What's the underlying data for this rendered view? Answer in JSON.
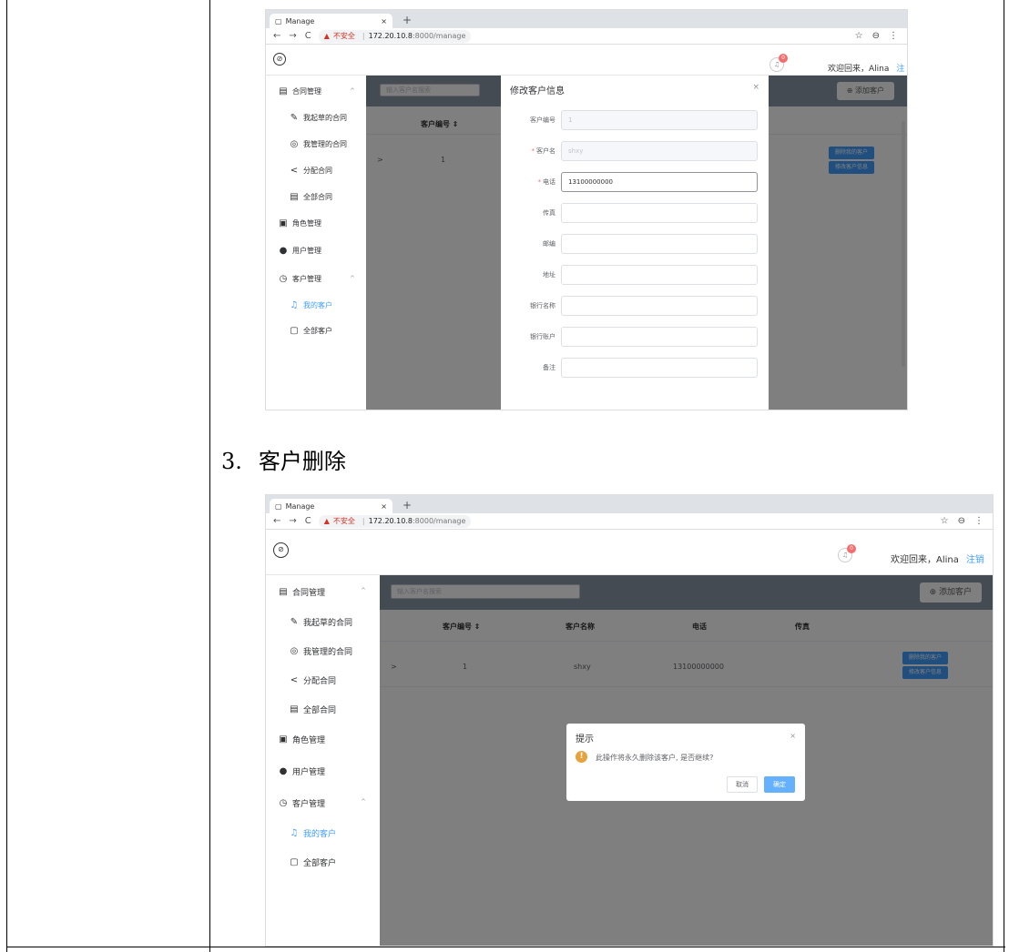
{
  "doc": {
    "step_number": "3.",
    "step_title": "客户删除"
  },
  "browser": {
    "tab_title": "Manage",
    "tab_close": "×",
    "new_tab": "+",
    "back": "←",
    "forward": "→",
    "reload": "C",
    "warning_icon": "▲",
    "insecure_label": "不安全",
    "separator": "|",
    "url_host": "172.20.10.8",
    "url_path": ":8000/manage",
    "star": "☆",
    "profile": "⊖",
    "menu": "⋮"
  },
  "app": {
    "compass_glyph": "⊘",
    "bell_glyph": "♫",
    "notification_count": "0",
    "welcome": "欢迎回来，Alina",
    "logout": "注销"
  },
  "sidebar": {
    "contract_mgmt": "合同管理",
    "my_draft_contracts": "我起草的合同",
    "my_managed_contracts": "我管理的合同",
    "assign_contracts": "分配合同",
    "all_contracts": "全部合同",
    "role_mgmt": "角色管理",
    "user_mgmt": "用户管理",
    "customer_mgmt": "客户管理",
    "my_customers": "我的客户",
    "all_customers": "全部客户",
    "collapse_arrow": "^",
    "icons": {
      "contract": "▤",
      "draft": "✎",
      "eye": "◎",
      "share": "<",
      "list": "▤",
      "role": "▣",
      "user": "●",
      "customer": "◷",
      "headset": "♫",
      "all_customers": "▢"
    }
  },
  "customers": {
    "search_placeholder": "输入客户名搜索",
    "add_button": "⊕ 添加客户",
    "columns": {
      "id": "客户编号 ⇕",
      "name": "客户名称",
      "phone": "电话",
      "fax": "传真"
    },
    "row": {
      "expand": ">",
      "id": "1",
      "name": "shxy",
      "phone": "13100000000"
    },
    "delete_button": "删除我的客户",
    "edit_button": "修改客户信息"
  },
  "edit_dialog": {
    "title": "修改客户信息",
    "close": "×",
    "fields": [
      {
        "label": "客户编号",
        "required": "",
        "value": "1"
      },
      {
        "label": "客户名",
        "required": "*",
        "value": "shxy"
      },
      {
        "label": "电话",
        "required": "*",
        "value": "13100000000"
      },
      {
        "label": "传真",
        "required": "",
        "value": ""
      },
      {
        "label": "邮编",
        "required": "",
        "value": ""
      },
      {
        "label": "地址",
        "required": "",
        "value": ""
      },
      {
        "label": "银行名称",
        "required": "",
        "value": ""
      },
      {
        "label": "银行账户",
        "required": "",
        "value": ""
      },
      {
        "label": "备注",
        "required": "",
        "value": ""
      }
    ]
  },
  "confirm_dialog": {
    "title": "提示",
    "close": "×",
    "icon": "!",
    "message": "此操作将永久删除该客户, 是否继续?",
    "cancel": "取消",
    "ok": "确定"
  }
}
